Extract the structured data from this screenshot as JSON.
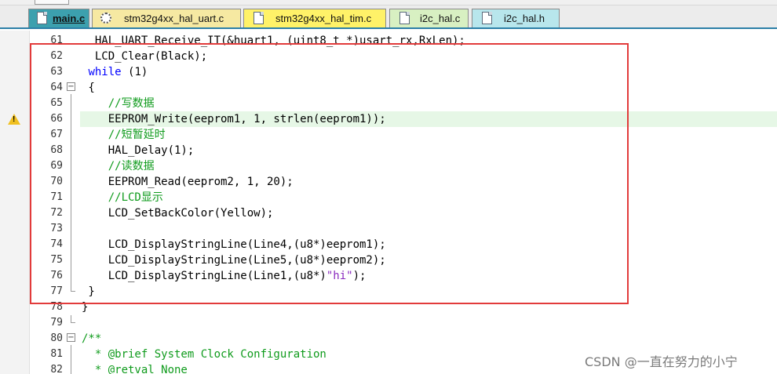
{
  "tabs": [
    {
      "label": "main.c",
      "active": true,
      "color": "#3ca0ae"
    },
    {
      "label": "stm32g4xx_hal_uart.c",
      "active": false,
      "color": "#f6e9a2"
    },
    {
      "label": "stm32g4xx_hal_tim.c",
      "active": false,
      "color": "#fff268"
    },
    {
      "label": "i2c_hal.c",
      "active": false,
      "color": "#d8f0c2"
    },
    {
      "label": "i2c_hal.h",
      "active": false,
      "color": "#b8e6ec"
    }
  ],
  "lines": [
    {
      "num": "61",
      "text": "  HAL_UART_Receive_IT(&huart1, (uint8_t *)usart_rx,RxLen);"
    },
    {
      "num": "62",
      "text": "  LCD_Clear(Black);"
    },
    {
      "num": "63",
      "text": " while (1)"
    },
    {
      "num": "64",
      "text": " {"
    },
    {
      "num": "65",
      "text": "    //写数据"
    },
    {
      "num": "66",
      "text": "    EEPROM_Write(eeprom1, 1, strlen(eeprom1));"
    },
    {
      "num": "67",
      "text": "    //短暂延时"
    },
    {
      "num": "68",
      "text": "    HAL_Delay(1);"
    },
    {
      "num": "69",
      "text": "    //读数据"
    },
    {
      "num": "70",
      "text": "    EEPROM_Read(eeprom2, 1, 20);"
    },
    {
      "num": "71",
      "text": "    //LCD显示"
    },
    {
      "num": "72",
      "text": "    LCD_SetBackColor(Yellow);"
    },
    {
      "num": "73",
      "text": ""
    },
    {
      "num": "74",
      "text": "    LCD_DisplayStringLine(Line4,(u8*)eeprom1);"
    },
    {
      "num": "75",
      "text": "    LCD_DisplayStringLine(Line5,(u8*)eeprom2);"
    },
    {
      "num": "76a",
      "text": "    LCD_DisplayStringLine(Line1,(u8*)"
    },
    {
      "num": "76b",
      "text": "\"hi\""
    },
    {
      "num": "76c",
      "text": ");"
    },
    {
      "num": "77",
      "text": " }"
    },
    {
      "num": "78",
      "text": "}"
    },
    {
      "num": "79",
      "text": ""
    },
    {
      "num": "80",
      "text": "/**"
    },
    {
      "num": "81",
      "text": "  * @brief System Clock Configuration"
    },
    {
      "num": "82",
      "text": "  * @retval None"
    }
  ],
  "line_numbers": {
    "n61": "61",
    "n62": "62",
    "n63": "63",
    "n64": "64",
    "n65": "65",
    "n66": "66",
    "n67": "67",
    "n68": "68",
    "n69": "69",
    "n70": "70",
    "n71": "71",
    "n72": "72",
    "n73": "73",
    "n74": "74",
    "n75": "75",
    "n76": "76",
    "n77": "77",
    "n78": "78",
    "n79": "79",
    "n80": "80",
    "n81": "81",
    "n82": "82"
  },
  "keywords": {
    "while": "while",
    "cond": " (1)"
  },
  "watermark": "CSDN @一直在努力的小宁",
  "colors": {
    "comment": "#0f9b1c",
    "keyword": "#0000ff",
    "string": "#8a2bbf",
    "highlight": "#e6f7e6",
    "annotation_box": "#e23b3b"
  }
}
